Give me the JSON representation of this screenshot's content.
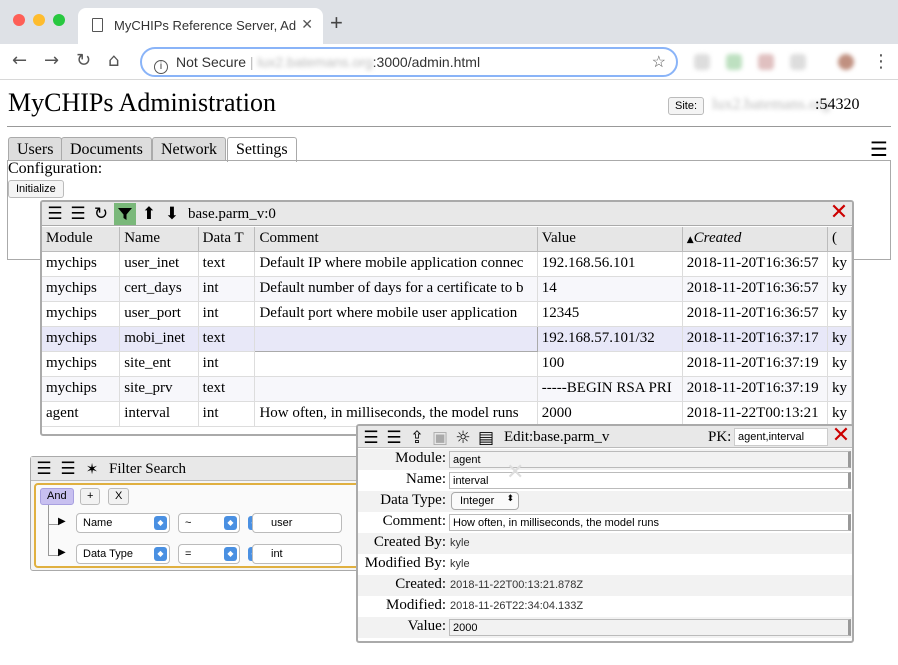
{
  "browser": {
    "tab_title": "MyCHIPs Reference Server, Ad",
    "tab_close": "✕",
    "new_tab": "+",
    "security_label": "Not Secure",
    "url_host": "lux2.batemans.org",
    "url_path": ":3000/admin.html"
  },
  "app": {
    "title": "MyCHIPs Administration",
    "site_label": "Site:",
    "site_host": "lux2.batemans.org",
    "site_port": ":54320",
    "tabs": [
      "Users",
      "Documents",
      "Network",
      "Settings"
    ],
    "active_tab": "Settings",
    "config_label": "Configuration:",
    "init_button": "Initialize"
  },
  "grid": {
    "title": "base.parm_v:0",
    "columns": [
      "Module",
      "Name",
      "Data T",
      "Comment",
      "Value",
      "Created",
      "("
    ],
    "rows": [
      [
        "mychips",
        "user_inet",
        "text",
        "Default IP where mobile application connec",
        "192.168.56.101",
        "2018-11-20T16:36:57",
        "ky"
      ],
      [
        "mychips",
        "cert_days",
        "int",
        "Default number of days for a certificate to b",
        "14",
        "2018-11-20T16:36:57",
        "ky"
      ],
      [
        "mychips",
        "user_port",
        "int",
        "Default port where mobile user application",
        "12345",
        "2018-11-20T16:36:57",
        "ky"
      ],
      [
        "mychips",
        "mobi_inet",
        "text",
        "",
        "192.168.57.101/32",
        "2018-11-20T16:37:17",
        "ky"
      ],
      [
        "mychips",
        "site_ent",
        "int",
        "",
        "100",
        "2018-11-20T16:37:19",
        "ky"
      ],
      [
        "mychips",
        "site_prv",
        "text",
        "",
        "-----BEGIN RSA PRI",
        "2018-11-20T16:37:19",
        "ky"
      ],
      [
        "agent",
        "interval",
        "int",
        "How often, in milliseconds, the model runs",
        "2000",
        "2018-11-22T00:13:21",
        "ky"
      ]
    ],
    "selected_row": 3
  },
  "filter": {
    "title": "Filter Search",
    "and_label": "And",
    "add_label": "+",
    "remove_label": "X",
    "rows": [
      {
        "field": "Name",
        "op": "~",
        "value": "user"
      },
      {
        "field": "Data Type",
        "op": "=",
        "value": "int"
      }
    ]
  },
  "edit": {
    "title": "Edit:base.parm_v",
    "pk_label": "PK:",
    "pk_value": "agent,interval",
    "fields": [
      {
        "label": "Module:",
        "value": "agent",
        "kind": "input"
      },
      {
        "label": "Name:",
        "value": "interval",
        "kind": "input"
      },
      {
        "label": "Data Type:",
        "value": "Integer",
        "kind": "select"
      },
      {
        "label": "Comment:",
        "value": "How often, in milliseconds, the model runs",
        "kind": "input"
      },
      {
        "label": "Created By:",
        "value": "kyle",
        "kind": "text"
      },
      {
        "label": "Modified By:",
        "value": "kyle",
        "kind": "text"
      },
      {
        "label": "Created:",
        "value": "2018-11-22T00:13:21.878Z",
        "kind": "text"
      },
      {
        "label": "Modified:",
        "value": "2018-11-26T22:34:04.133Z",
        "kind": "text"
      },
      {
        "label": "Value:",
        "value": "2000",
        "kind": "input"
      }
    ]
  },
  "icons": {
    "menu": "☰",
    "reload": "↻",
    "filter": "filter-icon",
    "sort_up": "⬆",
    "sort_down": "⬇",
    "close": "✕",
    "upload": "⇪",
    "settings": "☼"
  },
  "colors": {
    "close_red": "#cc0000",
    "filter_highlight": "#7ab87a",
    "and_button": "#c8c0f0",
    "filter_border": "#e0b040"
  }
}
